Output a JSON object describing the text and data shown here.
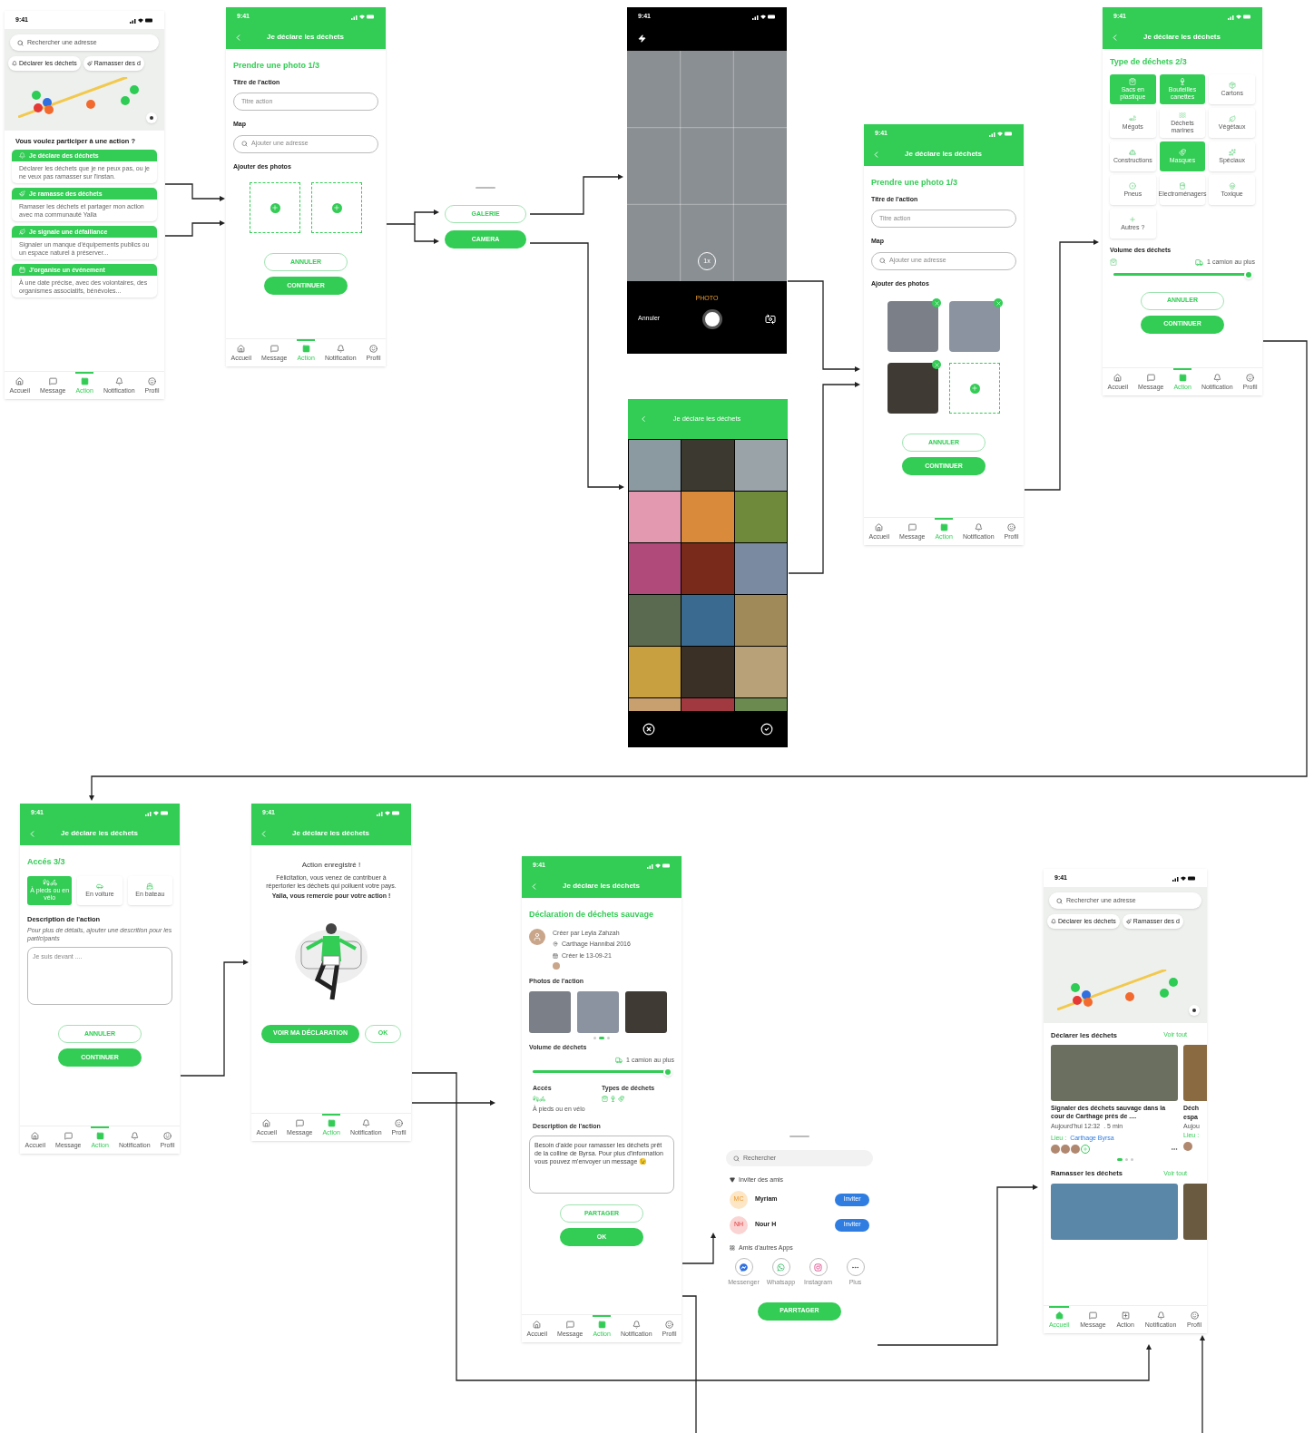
{
  "screens": [
    {
      "kind": "home_map",
      "time": "9:41",
      "search_placeholder": "Rechercher une adresse",
      "chips": [
        "Déclarer les déchets",
        "Ramasser des d"
      ],
      "question": "Vous voulez participer à une action ?",
      "actions": [
        {
          "title": "Je déclare des déchets",
          "text": "Déclarer les déchets que je ne peux pas, ou je ne veux pas ramasser sur l'instan."
        },
        {
          "title": "Je ramasse des déchets",
          "text": "Ramaser les déchets et partager mon action avec ma communauté Yalla"
        },
        {
          "title": "Je signale une défaillance",
          "text": "Signaler un manque d'équipements publics ou un espace naturel à préserver..."
        },
        {
          "title": "J'organise un événement",
          "text": "À une date précise, avec des volontaires, des organismes associatifs, bénévoles..."
        }
      ],
      "tabs": [
        {
          "label": "Accueil",
          "selected": false
        },
        {
          "label": "Message",
          "selected": false
        },
        {
          "label": "Action",
          "selected": true
        },
        {
          "label": "Notification",
          "selected": false
        },
        {
          "label": "Profil",
          "selected": false
        }
      ]
    },
    {
      "kind": "photo_form",
      "time": "9:41",
      "title": "Je déclare les déchets",
      "step": "Prendre une photo 1/3",
      "name_label": "Titre de l'action",
      "name_placeholder": "Titre action",
      "map_label": "Map",
      "map_placeholder": "Ajouter une adresse",
      "photos_label": "Ajouter des photos",
      "photos": [
        {
          "kind": "empty"
        },
        {
          "kind": "empty"
        }
      ],
      "buttons": [
        {
          "label": "ANNULER",
          "primary": false
        },
        {
          "label": "CONTINUER",
          "primary": true
        }
      ],
      "tabs": [
        {
          "label": "Accueil",
          "selected": false
        },
        {
          "label": "Message",
          "selected": false
        },
        {
          "label": "Action",
          "selected": true
        },
        {
          "label": "Notification",
          "selected": false
        },
        {
          "label": "Profil",
          "selected": false
        }
      ]
    },
    {
      "kind": "source_sheet",
      "buttons": [
        {
          "label": "GALERIE",
          "primary": false
        },
        {
          "label": "CAMERA",
          "primary": true
        }
      ]
    },
    {
      "kind": "camera",
      "time": "9:41",
      "zoom": "1x",
      "mode": "PHOTO",
      "cancel": "Annuler"
    },
    {
      "kind": "gallery",
      "title": "Je déclare les déchets"
    },
    {
      "kind": "photo_form",
      "time": "9:41",
      "title": "Je déclare les déchets",
      "step": "Prendre une photo 1/3",
      "name_label": "Titre de l'action",
      "name_placeholder": "Titre action",
      "map_label": "Map",
      "map_placeholder": "Ajouter une adresse",
      "photos_label": "Ajouter des photos",
      "photos": [
        {
          "kind": "photo"
        },
        {
          "kind": "photo"
        },
        {
          "kind": "photo"
        },
        {
          "kind": "empty"
        }
      ],
      "buttons": [
        {
          "label": "ANNULER",
          "primary": false
        },
        {
          "label": "CONTINUER",
          "primary": true
        }
      ],
      "tabs": [
        {
          "label": "Accueil",
          "selected": false
        },
        {
          "label": "Message",
          "selected": false
        },
        {
          "label": "Action",
          "selected": true
        },
        {
          "label": "Notification",
          "selected": false
        },
        {
          "label": "Profil",
          "selected": false
        }
      ]
    },
    {
      "kind": "waste_types",
      "time": "9:41",
      "title": "Je déclare les déchets",
      "step": "Type de déchets 2/3",
      "types": [
        {
          "label": "Sacs en plastique",
          "selected": true
        },
        {
          "label": "Bouteilles canettes",
          "selected": true
        },
        {
          "label": "Cartons",
          "selected": false
        },
        {
          "label": "Mégots",
          "selected": false
        },
        {
          "label": "Déchets marines",
          "selected": false
        },
        {
          "label": "Végétaux",
          "selected": false
        },
        {
          "label": "Constructions",
          "selected": false
        },
        {
          "label": "Masques",
          "selected": true
        },
        {
          "label": "Spéciaux",
          "selected": false
        },
        {
          "label": "Pneus",
          "selected": false
        },
        {
          "label": "Electroménagers",
          "selected": false
        },
        {
          "label": "Toxique",
          "selected": false
        },
        {
          "label": "Autres ?",
          "selected": false
        }
      ],
      "volume_label": "Volume des déchets",
      "volume_reading": "1 camion au plus",
      "level": 1,
      "buttons": [
        {
          "label": "ANNULER",
          "primary": false
        },
        {
          "label": "CONTINUER",
          "primary": true
        }
      ],
      "tabs": [
        {
          "label": "Accueil",
          "selected": false
        },
        {
          "label": "Message",
          "selected": false
        },
        {
          "label": "Action",
          "selected": true
        },
        {
          "label": "Notification",
          "selected": false
        },
        {
          "label": "Profil",
          "selected": false
        }
      ]
    },
    {
      "kind": "access",
      "time": "9:41",
      "title": "Je déclare les déchets",
      "step": "Accés 3/3",
      "options": [
        {
          "label": "À pieds ou en vélo",
          "selected": true
        },
        {
          "label": "En voiture",
          "selected": false
        },
        {
          "label": "En bateau",
          "selected": false
        }
      ],
      "description_label": "Description de l'action",
      "hint": "Pour plus de détails, ajouter une descrition pour les participants",
      "placeholder": "Je suis devant ....",
      "buttons": [
        {
          "label": "ANNULER",
          "primary": false
        },
        {
          "label": "CONTINUER",
          "primary": true
        }
      ],
      "tabs": [
        {
          "label": "Accueil",
          "selected": false
        },
        {
          "label": "Message",
          "selected": false
        },
        {
          "label": "Action",
          "selected": true
        },
        {
          "label": "Notification",
          "selected": false
        },
        {
          "label": "Profil",
          "selected": false
        }
      ]
    },
    {
      "kind": "confirmation",
      "time": "9:41",
      "title": "Je déclare les déchets",
      "heading": "Action enregistré !",
      "message": "Félicitation, vous venez de contribuer à répertorier les déchets qui polluent votre pays.",
      "thanks": "Yalla, vous remercie pour votre action !",
      "buttons": [
        {
          "label": "VOIR MA DÉCLARATION",
          "primary": true
        },
        {
          "label": "OK",
          "primary": false
        }
      ],
      "tabs": [
        {
          "label": "Accueil",
          "selected": false
        },
        {
          "label": "Message",
          "selected": false
        },
        {
          "label": "Action",
          "selected": true
        },
        {
          "label": "Notification",
          "selected": false
        },
        {
          "label": "Profil",
          "selected": false
        }
      ]
    },
    {
      "kind": "declaration",
      "time": "9:41",
      "title": "Je déclare les déchets",
      "heading": "Déclaration de déchets sauvage",
      "author": "Créer par Leyla Zahzah",
      "place": "Carthage Hannibal 2016",
      "date": "Créer le 13-09-21",
      "photos_label": "Photos de l'action",
      "dots": [
        {
          "selected": false
        },
        {
          "selected": true
        },
        {
          "selected": false
        }
      ],
      "volume_label": "Volume de déchets",
      "volume_reading": "1 camion au plus",
      "level": 1,
      "access_label": "Accés",
      "access_text": "À pieds ou en vélo",
      "types_label": "Types de déchets",
      "description_label": "Description de l'action",
      "description": "Besoin d'aide pour ramasser les déchets prêt de la colline de Byrsa. Pour plus d'information vous pouvez m'envoyer un message 😉",
      "buttons": [
        {
          "label": "PARTAGER",
          "primary": false
        },
        {
          "label": "OK",
          "primary": true
        }
      ],
      "tabs": [
        {
          "label": "Accueil",
          "selected": false
        },
        {
          "label": "Message",
          "selected": false
        },
        {
          "label": "Action",
          "selected": true
        },
        {
          "label": "Notification",
          "selected": false
        },
        {
          "label": "Profil",
          "selected": false
        }
      ]
    },
    {
      "kind": "share_sheet",
      "search_placeholder": "Rechercher",
      "friends_label": "Inviter des amis",
      "friends": [
        {
          "initials": "MC",
          "name": "Myriam",
          "button": "Inviter",
          "color": "#fde6c6"
        },
        {
          "initials": "NH",
          "name": "Nour H",
          "button": "Inviter",
          "color": "#fad3d3"
        }
      ],
      "apps_label": "Amis d'autres Apps",
      "apps": [
        {
          "kind": "messenger",
          "label": "Messenger"
        },
        {
          "kind": "whatsapp",
          "label": "Whatsapp"
        },
        {
          "kind": "instagram",
          "label": "Instagram"
        },
        {
          "kind": "more",
          "label": "Plus"
        }
      ],
      "share": "PARRTAGER"
    },
    {
      "kind": "home_feed",
      "time": "9:41",
      "search_placeholder": "Rechercher une adresse",
      "chips": [
        "Déclarer les déchets",
        "Ramasser des d"
      ],
      "sections": [
        {
          "title": "Déclarer les déchets",
          "link": "Voir tout",
          "card": {
            "title": "Signaler des déchets sauvage dans la cour de Carthage prés de ....",
            "meta": "Aujourd'hui 12:32  . 5 min",
            "place_label": "Lieu :",
            "place": "Carthage Byrsa"
          },
          "next_card": [
            "Déch",
            "espa",
            "Aujou",
            "Lieu :"
          ],
          "dots": [
            {
              "selected": true
            },
            {
              "selected": false
            },
            {
              "selected": false
            }
          ]
        },
        {
          "title": "Ramasser les déchets",
          "link": "Voir tout"
        }
      ],
      "tabs": [
        {
          "label": "Accueil",
          "selected": true
        },
        {
          "label": "Message",
          "selected": false
        },
        {
          "label": "Action",
          "selected": false
        },
        {
          "label": "Notification",
          "selected": false
        },
        {
          "label": "Profil",
          "selected": false
        }
      ]
    }
  ]
}
